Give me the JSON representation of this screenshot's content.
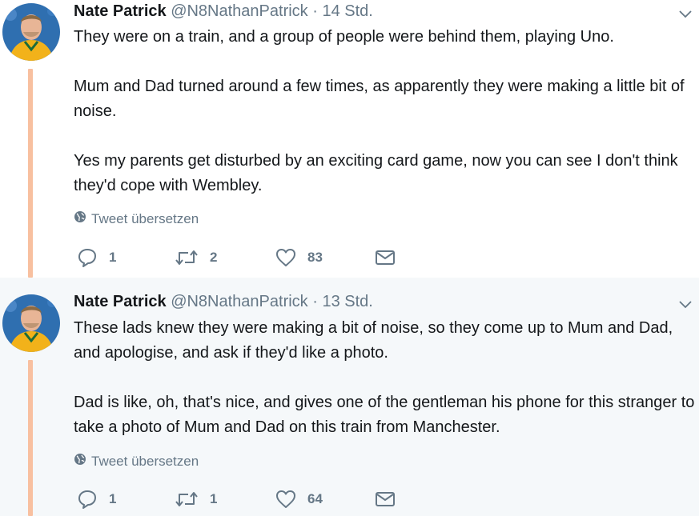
{
  "tweets": [
    {
      "name": "Nate Patrick",
      "handle": "@N8NathanPatrick",
      "dot": "·",
      "time": "14 Std.",
      "paragraphs": [
        "They were on a train, and a group of people were behind them, playing Uno.",
        "Mum and Dad turned around a few times, as apparently they were making a little bit of noise.",
        "Yes my parents get disturbed by an exciting card game, now you can see I don't think they'd cope with Wembley."
      ],
      "translate_label": "Tweet übersetzen",
      "replies": "1",
      "retweets": "2",
      "likes": "83"
    },
    {
      "name": "Nate Patrick",
      "handle": "@N8NathanPatrick",
      "dot": "·",
      "time": "13 Std.",
      "paragraphs": [
        "These lads knew they were making a bit of noise, so they come up to Mum and Dad, and apologise, and ask if they'd like a photo.",
        "Dad is like, oh, that's nice, and gives one of the gentleman his phone for this stranger to take a photo of Mum and Dad on this train from Manchester."
      ],
      "translate_label": "Tweet übersetzen",
      "replies": "1",
      "retweets": "1",
      "likes": "64"
    }
  ],
  "icons": {
    "reply": "reply-icon",
    "retweet": "retweet-icon",
    "like": "heart-icon",
    "dm": "envelope-icon",
    "translate": "globe-icon",
    "menu": "chevron-down-icon"
  },
  "colors": {
    "thread_line": "#f8c0a0",
    "secondary_text": "#657786",
    "highlight_bg": "#f5f8fa"
  }
}
